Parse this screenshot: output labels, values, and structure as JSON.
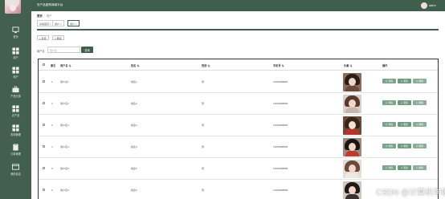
{
  "sidebar": {
    "items": [
      {
        "label": "首页",
        "icon": "computer-icon"
      },
      {
        "label": "用户",
        "icon": "grid-icon"
      },
      {
        "label": "商户",
        "icon": "grid-icon"
      },
      {
        "label": "产品分类",
        "icon": "briefcase-icon"
      },
      {
        "label": "农产品",
        "icon": "grid-icon"
      },
      {
        "label": "农场管理",
        "icon": "grid-icon"
      },
      {
        "label": "订单管理",
        "icon": "clipboard-icon"
      },
      {
        "label": "我的信息",
        "icon": "monitor-icon"
      }
    ]
  },
  "topbar": {
    "title": "农产品团购商城平台",
    "username": "admin"
  },
  "breadcrumb": {
    "home": "首页",
    "current": "用户"
  },
  "tabs": [
    {
      "label": "系统首页 ×",
      "active": false
    },
    {
      "label": "用户 ×",
      "active": false
    },
    {
      "label": "用户 ×",
      "active": true
    }
  ],
  "toolbar": {
    "add_label": "+ 新增",
    "delete_label": "× 删除"
  },
  "search": {
    "label": "用户名",
    "placeholder": "用户名",
    "button": "查询"
  },
  "table": {
    "headers": [
      "索引",
      "用户名 ⇅",
      "姓名 ⇅",
      "性别 ⇅",
      "手机号 ⇅",
      "头像 ⇅",
      "操作"
    ],
    "rows": [
      {
        "index": "1",
        "username": "用户名1",
        "name": "姓名1",
        "gender": "男",
        "phone": "13823888881",
        "photo_theme": "dark-hair"
      },
      {
        "index": "2",
        "username": "用户名2",
        "name": "姓名2",
        "gender": "男",
        "phone": "13823888882",
        "photo_theme": "brown-hair"
      },
      {
        "index": "3",
        "username": "用户名3",
        "name": "姓名3",
        "gender": "男",
        "phone": "13823888883",
        "photo_theme": "red-outfit"
      },
      {
        "index": "4",
        "username": "用户名4",
        "name": "姓名4",
        "gender": "男",
        "phone": "13823888884",
        "photo_theme": "dark-scarf"
      },
      {
        "index": "5",
        "username": "用户名5",
        "name": "姓名5",
        "gender": "男",
        "phone": "13823888885",
        "photo_theme": "light-hair"
      },
      {
        "index": "6",
        "username": "用户名6",
        "name": "姓名6",
        "gender": "男",
        "phone": "13823888886",
        "photo_theme": "dark-hair-2"
      }
    ],
    "actions": {
      "detail": "⊙ 详情",
      "edit": "⊙ 更新",
      "delete": "⊙ 删除"
    }
  },
  "watermark": "CSDN @计算机学姐",
  "colors": {
    "accent": "#43604e",
    "button": "#7aa58b",
    "sidebar": "#43604e"
  }
}
